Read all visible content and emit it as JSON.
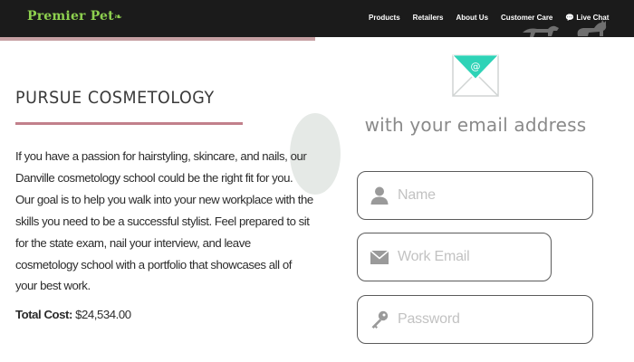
{
  "header": {
    "brand": "Premier Pet",
    "nav": [
      "Products",
      "Retailers",
      "About Us",
      "Customer Care",
      "Live Chat"
    ]
  },
  "left": {
    "title": "PURSUE COSMETOLOGY",
    "body": "If you have a passion for hairstyling, skincare, and nails, our Danville cosmetology school could be the right fit for you. Our goal is to help you walk into your new workplace with the skills you need to be a successful stylist. Feel prepared to sit for the state exam, nail your interview, and leave cosmetology school with a portfolio that showcases all of your best work.",
    "total_label": "Total Cost:",
    "total_value": "$24,534.00"
  },
  "right": {
    "heading": "with your email address",
    "fields": {
      "name": "Name",
      "work_email": "Work Email",
      "password": "Password"
    }
  },
  "colors": {
    "brand_green": "#8ed14f",
    "header_bg": "#1b1b1b",
    "title_rule": "#c2808b",
    "email_badge": "#2ed3b7"
  },
  "icons": [
    "paw-icon",
    "chat-bubble-icon",
    "email-badge-icon",
    "person-icon",
    "envelope-icon",
    "key-icon"
  ]
}
